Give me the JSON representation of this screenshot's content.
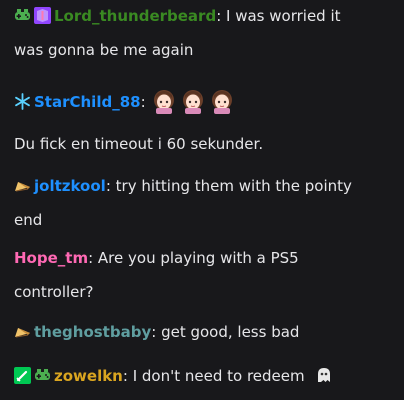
{
  "colors": {
    "background": "#18181b",
    "text": "#e6e6e9",
    "lord_thunderbeard": "#3a8a22",
    "starchild": "#1e90ff",
    "joltzkool": "#1e90ff",
    "hope_tm": "#ff69b4",
    "theghostbaby": "#5f9ea0",
    "zowelkn": "#daa520"
  },
  "messages": [
    {
      "badges": [
        "controller-icon",
        "turbo-badge-icon"
      ],
      "user": "Lord_thunderbeard",
      "sep": ":",
      "text_line1": "I was worried it",
      "text_line2": "was gonna be me again"
    },
    {
      "badges": [
        "snowflake-badge-icon"
      ],
      "user": "StarChild_88",
      "sep": ":",
      "emotes": [
        "anime-girl-emote",
        "anime-girl-emote",
        "anime-girl-emote"
      ]
    },
    {
      "system": "Du fick en timeout i 60 sekunder."
    },
    {
      "badges": [
        "bits-badge-icon"
      ],
      "user": "joltzkool",
      "sep": ":",
      "text_line1": "try hitting them with the pointy",
      "text_line2": "end"
    },
    {
      "user": "Hope_tm",
      "sep": ":",
      "text_line1": "Are you playing with a PS5",
      "text_line2": "controller?"
    },
    {
      "badges": [
        "bits-badge-icon"
      ],
      "user": "theghostbaby",
      "sep": ":",
      "text_line1": "get good, less bad"
    },
    {
      "badges": [
        "sword-badge-icon",
        "controller-icon"
      ],
      "user": "zowelkn",
      "sep": ":",
      "text_line1": "I don't need to redeem"
    }
  ]
}
